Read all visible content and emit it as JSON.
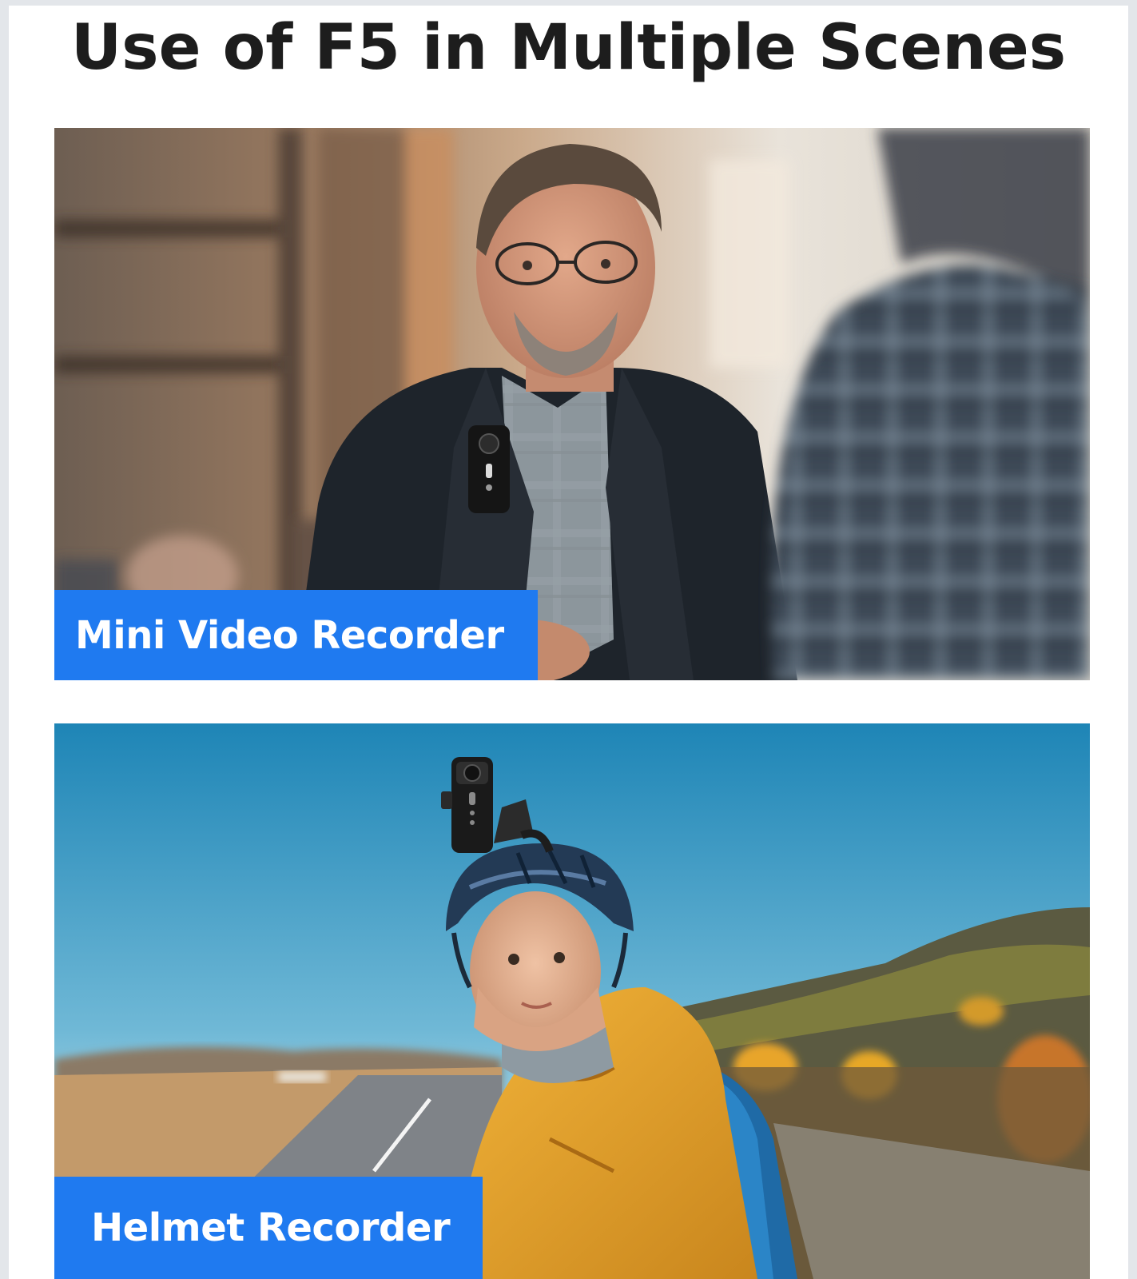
{
  "page": {
    "title": "Use of F5 in Multiple Scenes"
  },
  "scenes": [
    {
      "label": "Mini Video Recorder",
      "photo": "man-in-blazer-with-body-camera"
    },
    {
      "label": "Helmet Recorder",
      "photo": "cyclist-with-helmet-camera"
    }
  ],
  "colors": {
    "label_background": "#1f7af0",
    "label_text": "#ffffff",
    "title_text": "#1d1d1d"
  }
}
